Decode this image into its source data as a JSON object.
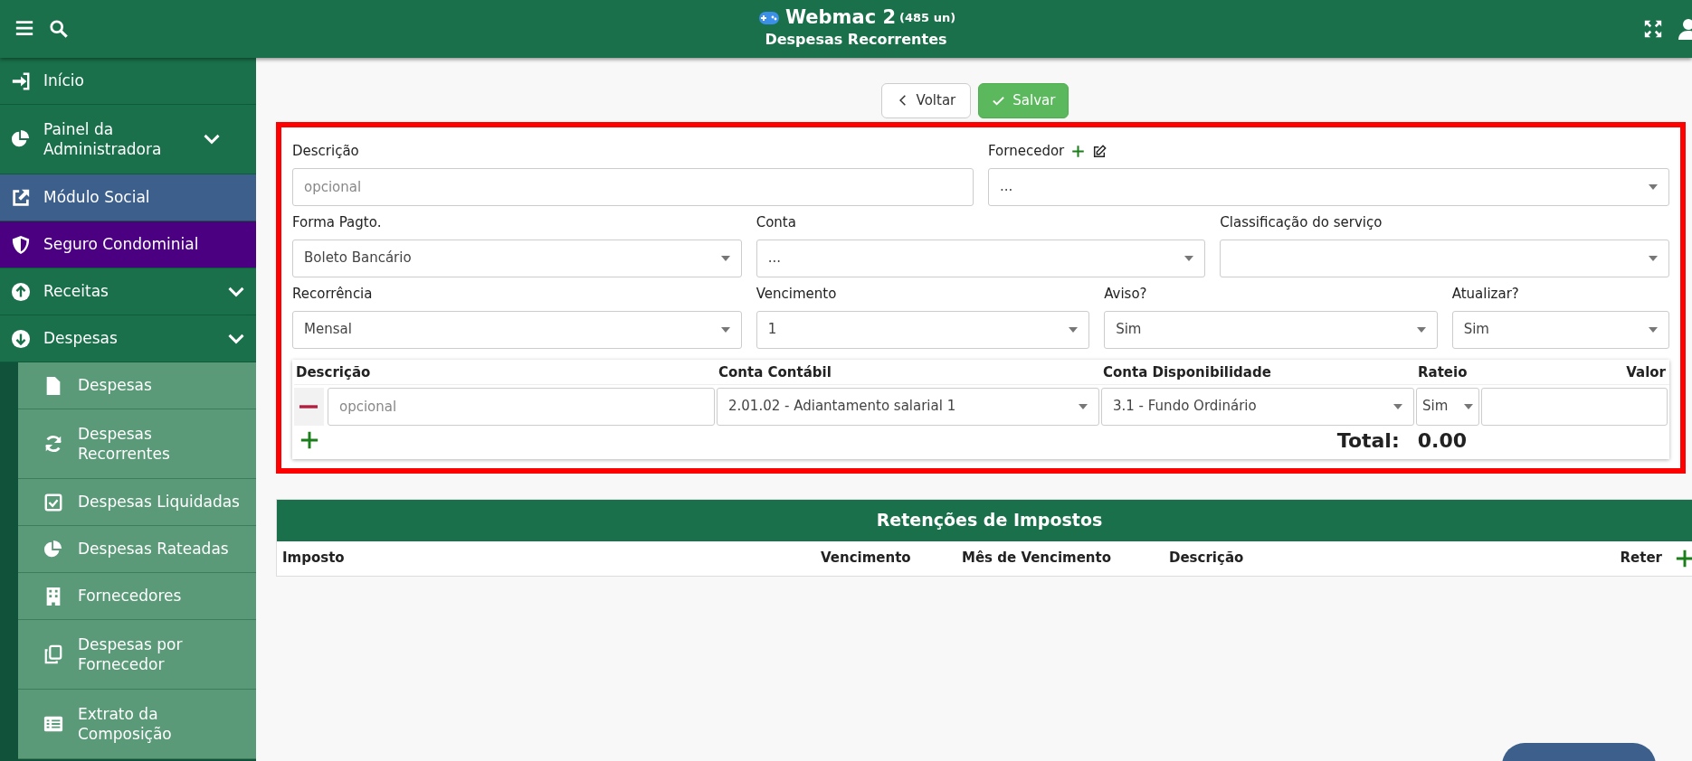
{
  "header": {
    "title": "Webmac 2",
    "count": "(485 un)",
    "subtitle": "Despesas Recorrentes"
  },
  "sidebar": {
    "items": [
      {
        "label": "Início",
        "color": "#19704a",
        "expandable": false
      },
      {
        "label": "Painel da Administradora",
        "color": "#19704a",
        "expandable": true
      },
      {
        "label": "Módulo Social",
        "color": "#3d5f8c",
        "expandable": false
      },
      {
        "label": "Seguro Condominial",
        "color": "#4b0082",
        "expandable": false
      },
      {
        "label": "Receitas",
        "color": "#19704a",
        "expandable": true
      },
      {
        "label": "Despesas",
        "color": "#19704a",
        "expandable": true,
        "children": [
          {
            "label": "Despesas"
          },
          {
            "label": "Despesas Recorrentes"
          },
          {
            "label": "Despesas Liquidadas"
          },
          {
            "label": "Despesas Rateadas"
          },
          {
            "label": "Fornecedores"
          },
          {
            "label": "Despesas por Fornecedor"
          },
          {
            "label": "Extrato da Composição"
          }
        ]
      }
    ]
  },
  "actions": {
    "back": "Voltar",
    "save": "Salvar"
  },
  "form": {
    "rows": [
      [
        {
          "label": "Descrição",
          "kind": "text",
          "placeholder": "opcional"
        },
        {
          "label": "Fornecedor",
          "kind": "select_actions",
          "value": "..."
        }
      ],
      [
        {
          "label": "Forma Pagto.",
          "kind": "select",
          "value": "Boleto Bancário"
        },
        {
          "label": "Conta",
          "kind": "select",
          "value": "..."
        },
        {
          "label": "Classificação do serviço",
          "kind": "select"
        }
      ],
      [
        {
          "label": "Recorrência",
          "kind": "select",
          "value": "Mensal"
        },
        {
          "label": "Vencimento",
          "kind": "select",
          "value": "1"
        },
        {
          "label": "Aviso?",
          "kind": "select",
          "value": "Sim"
        },
        {
          "label": "Atualizar?",
          "kind": "select",
          "value": "Sim"
        }
      ]
    ]
  },
  "items": {
    "columns": [
      "Descrição",
      "Conta Contábil",
      "Conta Disponibilidade",
      "Rateio",
      "Valor"
    ],
    "rows": [
      {
        "description_placeholder": "opcional",
        "conta_contabil": "2.01.02 - Adiantamento salarial 1",
        "conta_disponibilidade": "3.1 - Fundo Ordinário",
        "rateio": "Sim"
      }
    ],
    "total_label": "Total:",
    "total": "0.00"
  },
  "retencoes": {
    "title": "Retenções de Impostos",
    "columns": [
      "Imposto",
      "Vencimento",
      "Mês de Vencimento",
      "Descrição",
      "Reter"
    ]
  }
}
